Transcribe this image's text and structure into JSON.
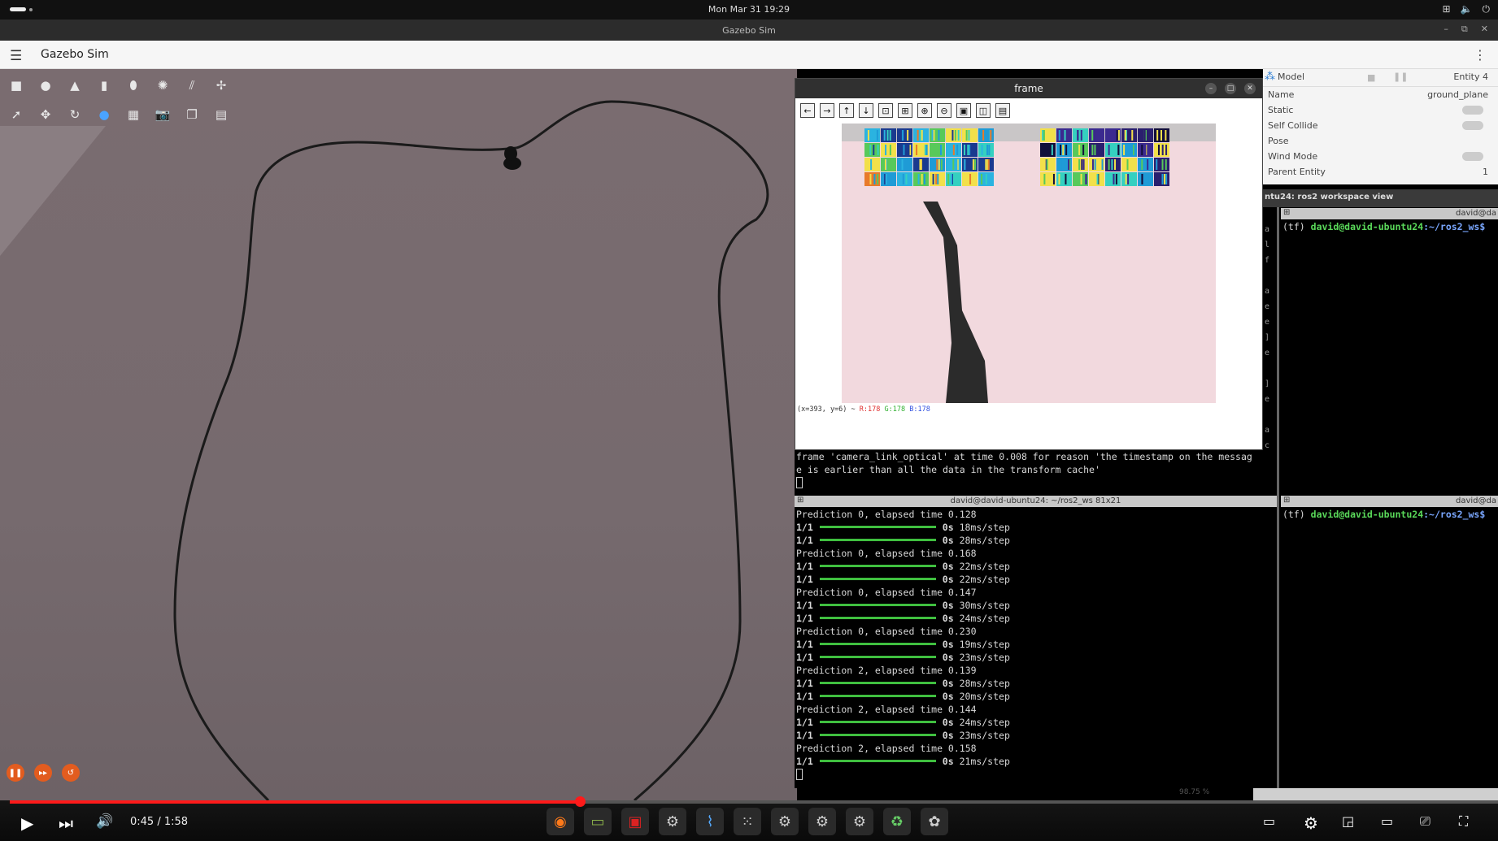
{
  "topbar": {
    "clock": "Mon Mar 31  19:29"
  },
  "window": {
    "title": "Gazebo Sim"
  },
  "app": {
    "name": "Gazebo Sim"
  },
  "frame_window": {
    "title": "frame",
    "status": {
      "coords": "(x=393, y=6) ~",
      "r": "R:178",
      "g": "G:178",
      "b": "B:178"
    }
  },
  "properties": {
    "header": "Model",
    "entity": "Entity 4",
    "rows": [
      {
        "key": "Name",
        "value": "ground_plane"
      },
      {
        "key": "Static",
        "value": ""
      },
      {
        "key": "Self Collide",
        "value": ""
      },
      {
        "key": "Pose",
        "value": ""
      },
      {
        "key": "Wind Mode",
        "value": ""
      },
      {
        "key": "Parent Entity",
        "value": "1"
      }
    ]
  },
  "terminals": {
    "workspace_title": "ntu24: ros2 workspace view",
    "top_left": {
      "lines": [
        "frame 'camera_link_optical' at time 0.008 for reason 'the timestamp on the messag",
        "e is earlier than all the data in the transform cache'"
      ],
      "side_chars": [
        "a",
        "l",
        "f",
        "",
        "a",
        "e",
        "e",
        "]",
        "e",
        "",
        "]",
        "e",
        "",
        "a",
        "c"
      ]
    },
    "top_right": {
      "title": "david@da",
      "prompt": "(tf)",
      "user": "david@david-ubuntu24",
      "path": ":~/ros2_ws$"
    },
    "bottom_left": {
      "title": "david@david-ubuntu24: ~/ros2_ws 81x21",
      "lines": [
        {
          "type": "pred",
          "text": "Prediction 0, elapsed time 0.128"
        },
        {
          "type": "step",
          "count": "1/1",
          "eta": "0s",
          "rate": "18ms/step"
        },
        {
          "type": "step",
          "count": "1/1",
          "eta": "0s",
          "rate": "28ms/step"
        },
        {
          "type": "pred",
          "text": "Prediction 0, elapsed time 0.168"
        },
        {
          "type": "step",
          "count": "1/1",
          "eta": "0s",
          "rate": "22ms/step"
        },
        {
          "type": "step",
          "count": "1/1",
          "eta": "0s",
          "rate": "22ms/step"
        },
        {
          "type": "pred",
          "text": "Prediction 0, elapsed time 0.147"
        },
        {
          "type": "step",
          "count": "1/1",
          "eta": "0s",
          "rate": "30ms/step"
        },
        {
          "type": "step",
          "count": "1/1",
          "eta": "0s",
          "rate": "24ms/step"
        },
        {
          "type": "pred",
          "text": "Prediction 0, elapsed time 0.230"
        },
        {
          "type": "step",
          "count": "1/1",
          "eta": "0s",
          "rate": "19ms/step"
        },
        {
          "type": "step",
          "count": "1/1",
          "eta": "0s",
          "rate": "23ms/step"
        },
        {
          "type": "pred",
          "text": "Prediction 2, elapsed time 0.139"
        },
        {
          "type": "step",
          "count": "1/1",
          "eta": "0s",
          "rate": "28ms/step"
        },
        {
          "type": "step",
          "count": "1/1",
          "eta": "0s",
          "rate": "20ms/step"
        },
        {
          "type": "pred",
          "text": "Prediction 2, elapsed time 0.144"
        },
        {
          "type": "step",
          "count": "1/1",
          "eta": "0s",
          "rate": "24ms/step"
        },
        {
          "type": "step",
          "count": "1/1",
          "eta": "0s",
          "rate": "23ms/step"
        },
        {
          "type": "pred",
          "text": "Prediction 2, elapsed time 0.158"
        },
        {
          "type": "step",
          "count": "1/1",
          "eta": "0s",
          "rate": "21ms/step"
        }
      ]
    },
    "bottom_right": {
      "title": "david@da",
      "prompt": "(tf)",
      "user": "david@david-ubuntu24",
      "path": ":~/ros2_ws$"
    },
    "zoom_readout": "98.75 %"
  },
  "video": {
    "time": "0:45 / 1:58",
    "progress": 0.383
  },
  "icons": {
    "play": "play-icon",
    "next": "next-icon",
    "volume": "volume-icon",
    "subtitles": "subtitles-icon",
    "settings": "settings-icon",
    "miniplayer": "miniplayer-icon",
    "theater": "theater-icon",
    "cast": "cast-icon",
    "fullscreen": "fullscreen-icon"
  },
  "colors": {
    "accent": "#e25c1f",
    "progress": "#ff1a1a",
    "terminal_green": "#5ad95a"
  }
}
